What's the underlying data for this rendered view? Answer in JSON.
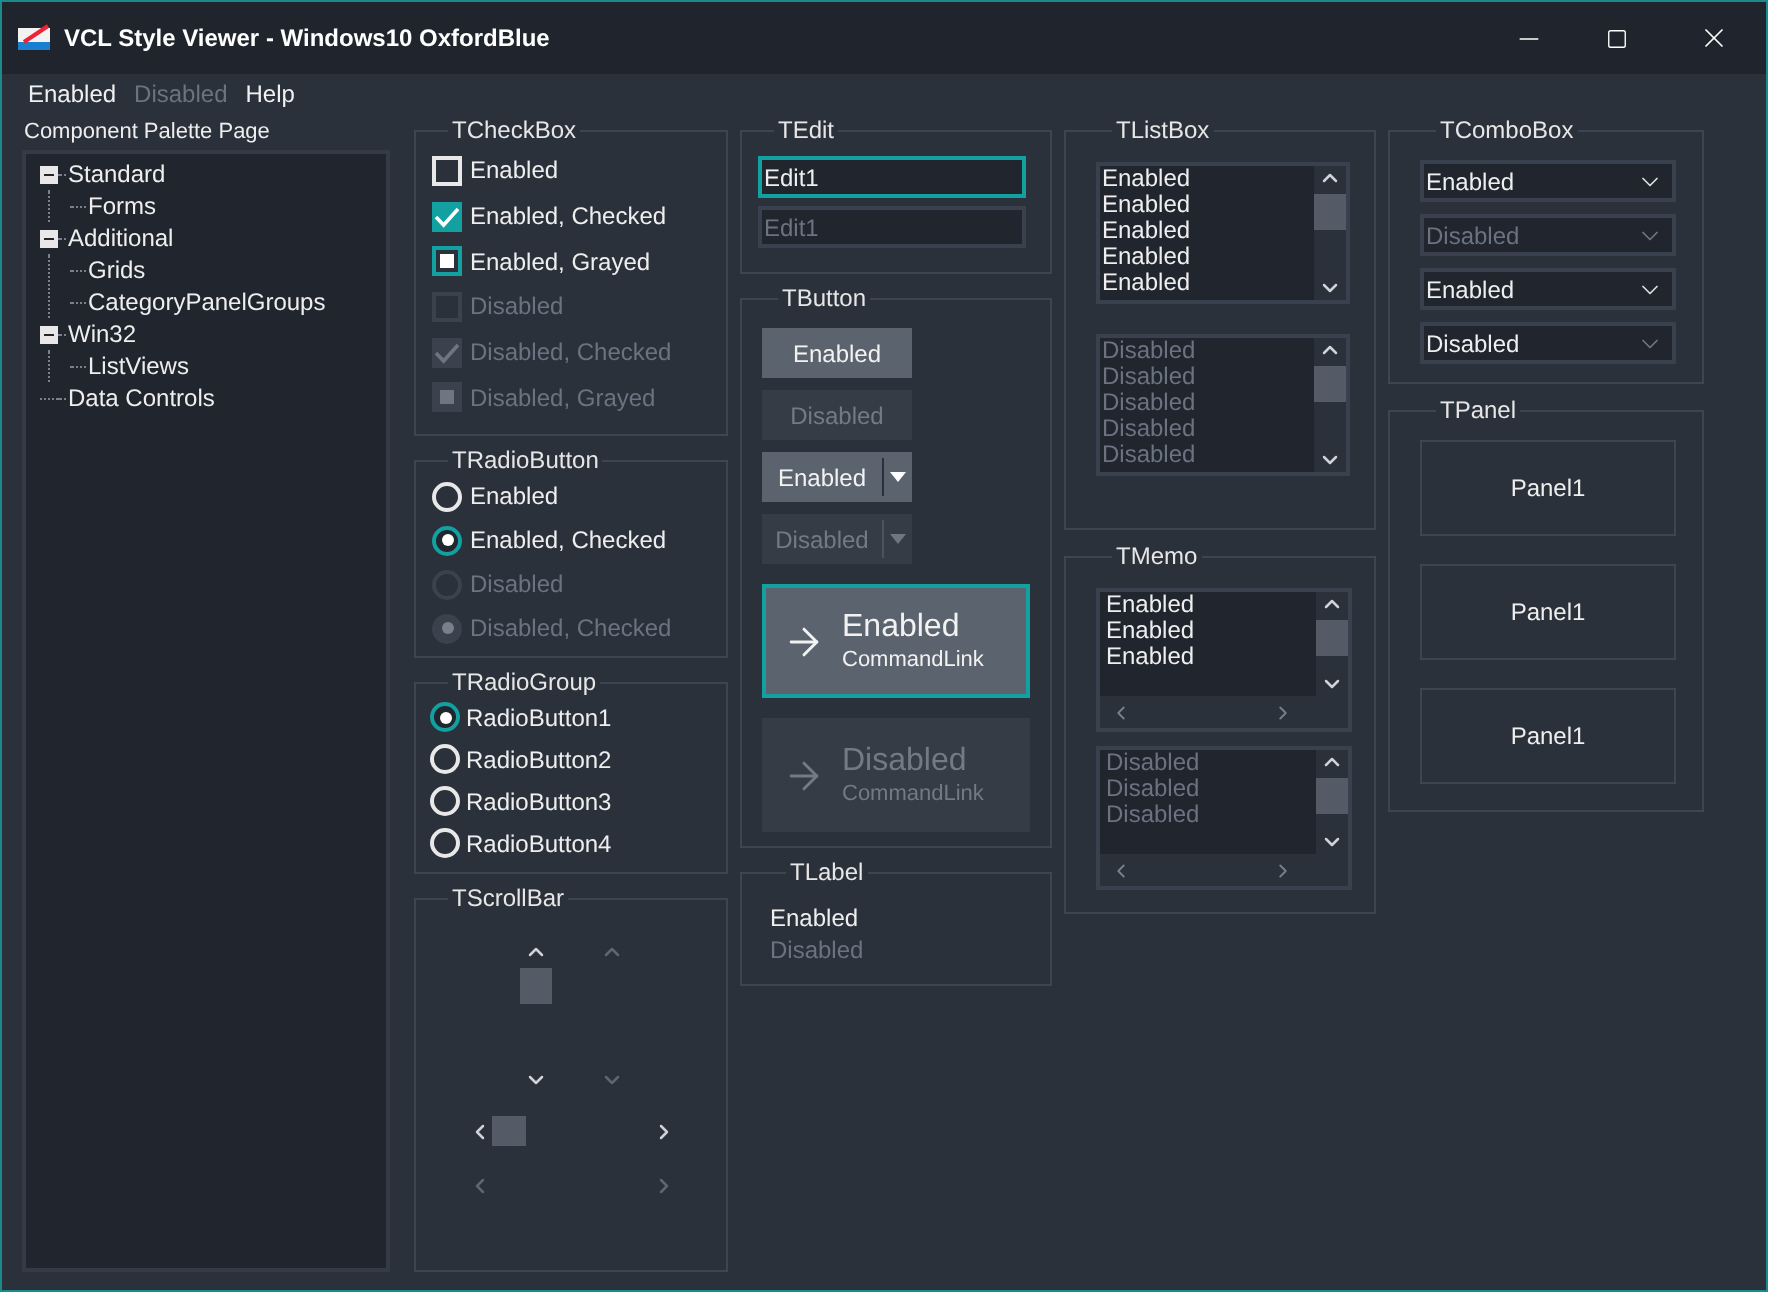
{
  "window": {
    "title": "VCL Style Viewer - Windows10 OxfordBlue"
  },
  "menu": [
    {
      "label": "Enabled",
      "disabled": false
    },
    {
      "label": "Disabled",
      "disabled": true
    },
    {
      "label": "Help",
      "disabled": false
    }
  ],
  "palette": {
    "label": "Component Palette Page",
    "tree": [
      {
        "label": "Standard",
        "expanded": true,
        "children": [
          {
            "label": "Forms"
          }
        ]
      },
      {
        "label": "Additional",
        "expanded": true,
        "children": [
          {
            "label": "Grids"
          },
          {
            "label": "CategoryPanelGroups"
          }
        ]
      },
      {
        "label": "Win32",
        "expanded": true,
        "children": [
          {
            "label": "ListViews"
          }
        ]
      },
      {
        "label": "Data Controls"
      }
    ]
  },
  "checkbox": {
    "title": "TCheckBox",
    "items": [
      {
        "label": "Enabled",
        "kind": "unchecked",
        "disabled": false
      },
      {
        "label": "Enabled, Checked",
        "kind": "checked",
        "disabled": false
      },
      {
        "label": "Enabled, Grayed",
        "kind": "grayed",
        "disabled": false
      },
      {
        "label": "Disabled",
        "kind": "unchecked",
        "disabled": true
      },
      {
        "label": "Disabled, Checked",
        "kind": "checked",
        "disabled": true
      },
      {
        "label": "Disabled, Grayed",
        "kind": "grayed",
        "disabled": true
      }
    ]
  },
  "radio_button": {
    "title": "TRadioButton",
    "items": [
      {
        "label": "Enabled",
        "checked": false,
        "disabled": false
      },
      {
        "label": "Enabled, Checked",
        "checked": true,
        "disabled": false
      },
      {
        "label": "Disabled",
        "checked": false,
        "disabled": true
      },
      {
        "label": "Disabled, Checked",
        "checked": true,
        "disabled": true
      }
    ]
  },
  "radio_group": {
    "title": "TRadioGroup",
    "items": [
      {
        "label": "RadioButton1",
        "selected": true
      },
      {
        "label": "RadioButton2",
        "selected": false
      },
      {
        "label": "RadioButton3",
        "selected": false
      },
      {
        "label": "RadioButton4",
        "selected": false
      }
    ]
  },
  "scrollbar": {
    "title": "TScrollBar",
    "vertical": [
      {
        "disabled": false
      },
      {
        "disabled": true
      }
    ],
    "horizontal": [
      {
        "disabled": false
      },
      {
        "disabled": true
      }
    ]
  },
  "edit": {
    "title": "TEdit",
    "fields": [
      {
        "value": "Edit1",
        "focused": true,
        "disabled": false
      },
      {
        "value": "Edit1",
        "focused": false,
        "disabled": true
      }
    ]
  },
  "button": {
    "title": "TButton",
    "items": [
      {
        "kind": "push",
        "label": "Enabled",
        "disabled": false
      },
      {
        "kind": "push",
        "label": "Disabled",
        "disabled": true
      },
      {
        "kind": "split",
        "label": "Enabled",
        "disabled": false
      },
      {
        "kind": "split",
        "label": "Disabled",
        "disabled": true
      },
      {
        "kind": "commandlink",
        "label": "Enabled",
        "note": "CommandLink",
        "disabled": false,
        "focused": true
      },
      {
        "kind": "commandlink",
        "label": "Disabled",
        "note": "CommandLink",
        "disabled": true,
        "focused": false
      }
    ]
  },
  "label": {
    "title": "TLabel",
    "items": [
      {
        "text": "Enabled",
        "disabled": false
      },
      {
        "text": "Disabled",
        "disabled": true
      }
    ]
  },
  "listbox": {
    "title": "TListBox",
    "lists": [
      {
        "disabled": false,
        "items": [
          "Enabled",
          "Enabled",
          "Enabled",
          "Enabled",
          "Enabled"
        ]
      },
      {
        "disabled": true,
        "items": [
          "Disabled",
          "Disabled",
          "Disabled",
          "Disabled",
          "Disabled"
        ]
      }
    ]
  },
  "memo": {
    "title": "TMemo",
    "memos": [
      {
        "disabled": false,
        "lines": [
          "Enabled",
          "Enabled",
          "Enabled"
        ]
      },
      {
        "disabled": true,
        "lines": [
          "Disabled",
          "Disabled",
          "Disabled"
        ]
      }
    ]
  },
  "combobox": {
    "title": "TComboBox",
    "items": [
      {
        "value": "Enabled",
        "disabled": false
      },
      {
        "value": "Disabled",
        "disabled": true
      },
      {
        "value": "Enabled",
        "disabled": false
      },
      {
        "value": "Disabled",
        "disabled": false
      }
    ]
  },
  "panel": {
    "title": "TPanel",
    "panels": [
      {
        "caption": "Panel1"
      },
      {
        "caption": "Panel1"
      },
      {
        "caption": "Panel1"
      }
    ]
  }
}
